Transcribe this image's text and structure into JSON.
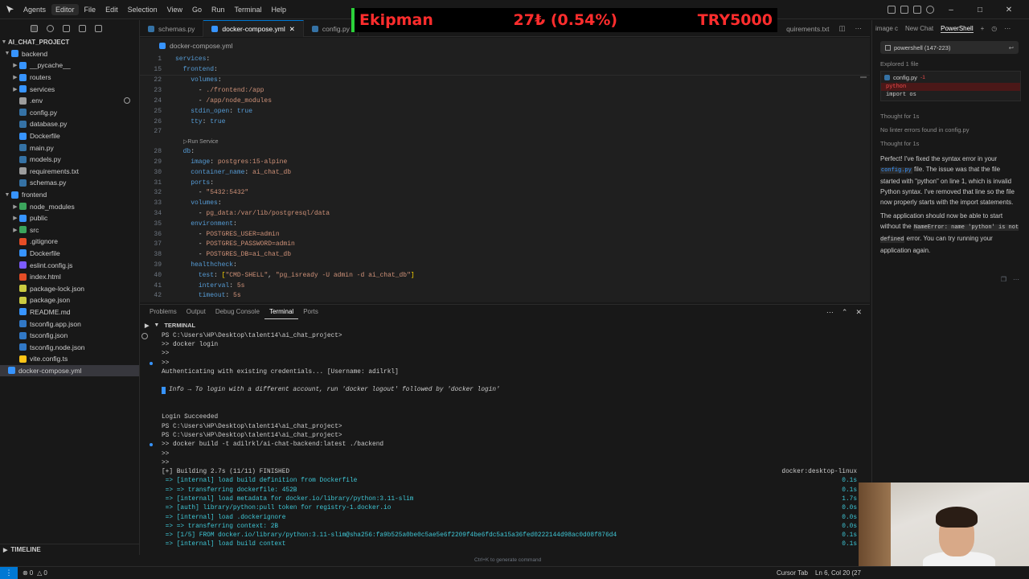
{
  "titlebar": {
    "menu": [
      "Agents",
      "Editor",
      "File",
      "Edit",
      "Selection",
      "View",
      "Go",
      "Run",
      "Terminal",
      "Help"
    ],
    "active_menu": "Editor"
  },
  "ticker": {
    "name": "Ekipman",
    "change": "27₺ (0.54%)",
    "amount": "TRY5000"
  },
  "sidebar": {
    "root": "AI_CHAT_PROJECT",
    "items": [
      {
        "label": "backend",
        "type": "folder",
        "open": true,
        "depth": 1,
        "color": "#3794ff"
      },
      {
        "label": "__pycache__",
        "type": "folder",
        "open": false,
        "depth": 2,
        "color": "#3794ff"
      },
      {
        "label": "routers",
        "type": "folder",
        "open": false,
        "depth": 2,
        "color": "#3794ff"
      },
      {
        "label": "services",
        "type": "folder",
        "open": false,
        "depth": 2,
        "color": "#3794ff"
      },
      {
        "label": ".env",
        "type": "file",
        "depth": 2,
        "color": "#9d9d9d"
      },
      {
        "label": "config.py",
        "type": "file",
        "depth": 2,
        "color": "#3572a5"
      },
      {
        "label": "database.py",
        "type": "file",
        "depth": 2,
        "color": "#3572a5"
      },
      {
        "label": "Dockerfile",
        "type": "file",
        "depth": 2,
        "color": "#3794ff"
      },
      {
        "label": "main.py",
        "type": "file",
        "depth": 2,
        "color": "#3572a5"
      },
      {
        "label": "models.py",
        "type": "file",
        "depth": 2,
        "color": "#3572a5"
      },
      {
        "label": "requirements.txt",
        "type": "file",
        "depth": 2,
        "color": "#9d9d9d"
      },
      {
        "label": "schemas.py",
        "type": "file",
        "depth": 2,
        "color": "#3572a5"
      },
      {
        "label": "frontend",
        "type": "folder",
        "open": true,
        "depth": 1,
        "color": "#3794ff"
      },
      {
        "label": "node_modules",
        "type": "folder",
        "open": false,
        "depth": 2,
        "color": "#3ba55c"
      },
      {
        "label": "public",
        "type": "folder",
        "open": false,
        "depth": 2,
        "color": "#3794ff"
      },
      {
        "label": "src",
        "type": "folder",
        "open": false,
        "depth": 2,
        "color": "#3ba55c"
      },
      {
        "label": ".gitignore",
        "type": "file",
        "depth": 2,
        "color": "#e44d26"
      },
      {
        "label": "Dockerfile",
        "type": "file",
        "depth": 2,
        "color": "#3794ff"
      },
      {
        "label": "eslint.config.js",
        "type": "file",
        "depth": 2,
        "color": "#7c5cff"
      },
      {
        "label": "index.html",
        "type": "file",
        "depth": 2,
        "color": "#e44d26"
      },
      {
        "label": "package-lock.json",
        "type": "file",
        "depth": 2,
        "color": "#cbcb41"
      },
      {
        "label": "package.json",
        "type": "file",
        "depth": 2,
        "color": "#cbcb41"
      },
      {
        "label": "README.md",
        "type": "file",
        "depth": 2,
        "color": "#3794ff"
      },
      {
        "label": "tsconfig.app.json",
        "type": "file",
        "depth": 2,
        "color": "#3178c6"
      },
      {
        "label": "tsconfig.json",
        "type": "file",
        "depth": 2,
        "color": "#3178c6"
      },
      {
        "label": "tsconfig.node.json",
        "type": "file",
        "depth": 2,
        "color": "#3178c6"
      },
      {
        "label": "vite.config.ts",
        "type": "file",
        "depth": 2,
        "color": "#ffc517"
      },
      {
        "label": "docker-compose.yml",
        "type": "file",
        "depth": 1,
        "color": "#3794ff",
        "selected": true
      }
    ],
    "timeline": "TIMELINE"
  },
  "tabs": [
    {
      "label": "schemas.py",
      "active": false,
      "color": "#3572a5"
    },
    {
      "label": "docker-compose.yml",
      "active": true,
      "color": "#3794ff"
    },
    {
      "label": "config.py",
      "active": false,
      "color": "#3572a5"
    }
  ],
  "tab_right_label": "quirements.txt",
  "breadcrumb": "docker-compose.yml",
  "editor": {
    "sticky": [
      {
        "n": "1",
        "code": [
          [
            "k",
            "services"
          ],
          [
            "t",
            ":"
          ]
        ]
      },
      {
        "n": "15",
        "code": [
          [
            "t",
            "  "
          ],
          [
            "k",
            "frontend"
          ],
          [
            "t",
            ":"
          ]
        ]
      }
    ],
    "lines": [
      {
        "n": "22",
        "code": [
          [
            "t",
            "    "
          ],
          [
            "k",
            "volumes"
          ],
          [
            "t",
            ":"
          ]
        ]
      },
      {
        "n": "23",
        "code": [
          [
            "t",
            "      - "
          ],
          [
            "s",
            "./frontend:/app"
          ]
        ]
      },
      {
        "n": "24",
        "code": [
          [
            "t",
            "      - "
          ],
          [
            "s",
            "/app/node_modules"
          ]
        ]
      },
      {
        "n": "25",
        "code": [
          [
            "t",
            "    "
          ],
          [
            "k",
            "stdin_open"
          ],
          [
            "t",
            ": "
          ],
          [
            "b",
            "true"
          ]
        ]
      },
      {
        "n": "26",
        "code": [
          [
            "t",
            "    "
          ],
          [
            "k",
            "tty"
          ],
          [
            "t",
            ": "
          ],
          [
            "b",
            "true"
          ]
        ]
      },
      {
        "n": "27",
        "code": []
      },
      {
        "lens": "Run Service"
      },
      {
        "n": "28",
        "code": [
          [
            "t",
            "  "
          ],
          [
            "k",
            "db"
          ],
          [
            "t",
            ":"
          ]
        ]
      },
      {
        "n": "29",
        "code": [
          [
            "t",
            "    "
          ],
          [
            "k",
            "image"
          ],
          [
            "t",
            ": "
          ],
          [
            "s",
            "postgres:15-alpine"
          ]
        ]
      },
      {
        "n": "30",
        "code": [
          [
            "t",
            "    "
          ],
          [
            "k",
            "container_name"
          ],
          [
            "t",
            ": "
          ],
          [
            "s",
            "ai_chat_db"
          ]
        ]
      },
      {
        "n": "31",
        "code": [
          [
            "t",
            "    "
          ],
          [
            "k",
            "ports"
          ],
          [
            "t",
            ":"
          ]
        ]
      },
      {
        "n": "32",
        "code": [
          [
            "t",
            "      - "
          ],
          [
            "s",
            "\"5432:5432\""
          ]
        ]
      },
      {
        "n": "33",
        "code": [
          [
            "t",
            "    "
          ],
          [
            "k",
            "volumes"
          ],
          [
            "t",
            ":"
          ]
        ]
      },
      {
        "n": "34",
        "code": [
          [
            "t",
            "      - "
          ],
          [
            "s",
            "pg_data:/var/lib/postgresql/data"
          ]
        ]
      },
      {
        "n": "35",
        "code": [
          [
            "t",
            "    "
          ],
          [
            "k",
            "environment"
          ],
          [
            "t",
            ":"
          ]
        ]
      },
      {
        "n": "36",
        "code": [
          [
            "t",
            "      - "
          ],
          [
            "s",
            "POSTGRES_USER=admin"
          ]
        ]
      },
      {
        "n": "37",
        "code": [
          [
            "t",
            "      - "
          ],
          [
            "s",
            "POSTGRES_PASSWORD=admin"
          ]
        ]
      },
      {
        "n": "38",
        "code": [
          [
            "t",
            "      - "
          ],
          [
            "s",
            "POSTGRES_DB=ai_chat_db"
          ]
        ]
      },
      {
        "n": "39",
        "code": [
          [
            "t",
            "    "
          ],
          [
            "k",
            "healthcheck"
          ],
          [
            "t",
            ":"
          ]
        ]
      },
      {
        "n": "40",
        "code": [
          [
            "t",
            "      "
          ],
          [
            "k",
            "test"
          ],
          [
            "t",
            ": "
          ],
          [
            "y",
            "["
          ],
          [
            "s",
            "\"CMD-SHELL\""
          ],
          [
            "t",
            ", "
          ],
          [
            "s",
            "\"pg_isready -U admin -d ai_chat_db\""
          ],
          [
            "y",
            "]"
          ]
        ]
      },
      {
        "n": "41",
        "code": [
          [
            "t",
            "      "
          ],
          [
            "k",
            "interval"
          ],
          [
            "t",
            ": "
          ],
          [
            "s",
            "5s"
          ]
        ]
      },
      {
        "n": "42",
        "code": [
          [
            "t",
            "      "
          ],
          [
            "k",
            "timeout"
          ],
          [
            "t",
            ": "
          ],
          [
            "s",
            "5s"
          ]
        ]
      }
    ]
  },
  "panel": {
    "tabs": [
      "Problems",
      "Output",
      "Debug Console",
      "Terminal",
      "Ports"
    ],
    "active": "Terminal",
    "terminal_title": "TERMINAL"
  },
  "terminal": [
    {
      "text": "PS C:\\Users\\HP\\Desktop\\talent14\\ai_chat_project>",
      "dot": false
    },
    {
      "text": ">> docker login",
      "dot": false
    },
    {
      "text": ">>",
      "dot": false
    },
    {
      "text": ">>",
      "dot": true
    },
    {
      "text": "Authenticating with existing credentials... [Username: adilrkl]",
      "dot": false
    },
    {
      "text": "",
      "dot": false
    },
    {
      "text": "Info → To login with a different account, run 'docker logout' followed by 'docker login'",
      "dot": false,
      "style": "info"
    },
    {
      "text": "",
      "dot": false
    },
    {
      "text": "",
      "dot": false
    },
    {
      "text": "Login Succeeded",
      "dot": false
    },
    {
      "text": "PS C:\\Users\\HP\\Desktop\\talent14\\ai_chat_project>",
      "dot": false
    },
    {
      "text": "PS C:\\Users\\HP\\Desktop\\talent14\\ai_chat_project>",
      "dot": false
    },
    {
      "text": ">> docker build -t adilrkl/ai-chat-backend:latest ./backend",
      "dot": true
    },
    {
      "text": ">>",
      "dot": false
    },
    {
      "text": ">>",
      "dot": false
    },
    {
      "text": "[+] Building 2.7s (11/11) FINISHED",
      "dot": false,
      "right": "docker:desktop-linux"
    },
    {
      "text": " => [internal] load build definition from Dockerfile",
      "dot": false,
      "right": "0.1s",
      "style": "cyan"
    },
    {
      "text": " => => transferring dockerfile: 452B",
      "dot": false,
      "right": "0.1s",
      "style": "cyan"
    },
    {
      "text": " => [internal] load metadata for docker.io/library/python:3.11-slim",
      "dot": false,
      "right": "1.7s",
      "style": "cyan"
    },
    {
      "text": " => [auth] library/python:pull token for registry-1.docker.io",
      "dot": false,
      "right": "0.0s",
      "style": "cyan"
    },
    {
      "text": " => [internal] load .dockerignore",
      "dot": false,
      "right": "0.0s",
      "style": "cyan"
    },
    {
      "text": " => => transferring context: 2B",
      "dot": false,
      "right": "0.0s",
      "style": "cyan"
    },
    {
      "text": " => [1/5] FROM docker.io/library/python:3.11-slim@sha256:fa9b525a0be0c5ae5e6f2209f4be6fdc5a15a36fed0222144d98ac0d08f876d4",
      "dot": false,
      "right": "0.1s",
      "style": "cyan"
    },
    {
      "text": " => [internal] load build context",
      "dot": false,
      "right": "0.1s",
      "style": "cyan"
    }
  ],
  "hint": "Ctrl+K to generate command",
  "chat": {
    "tabs": [
      "image c",
      "New Chat",
      "PowerShell"
    ],
    "active_tab": "PowerShell",
    "context_chip": "powershell (147-223)",
    "explored": "Explored 1 file",
    "file_name": "config.py",
    "file_badge": "-1",
    "deleted_line": "python",
    "kept_line": "import os",
    "thought1": "Thought for 1s",
    "linter": "No linter errors found in config.py",
    "thought2": "Thought for 1s",
    "para1_a": "Perfect! I've fixed the syntax error in your ",
    "para1_code": "config.py",
    "para1_b": " file. The issue was that the file started with \"python\" on line 1, which is invalid Python syntax. I've removed that line so the file now properly starts with the import statements.",
    "para2_a": "The application should now be able to start without the ",
    "para2_code": "NameError: name 'python' is not defined",
    "para2_b": " error. You can try running your application again."
  },
  "status": {
    "problems": "0",
    "warnings": "0",
    "cursor_tab": "Cursor Tab",
    "position": "Ln 6, Col 20 (27"
  }
}
